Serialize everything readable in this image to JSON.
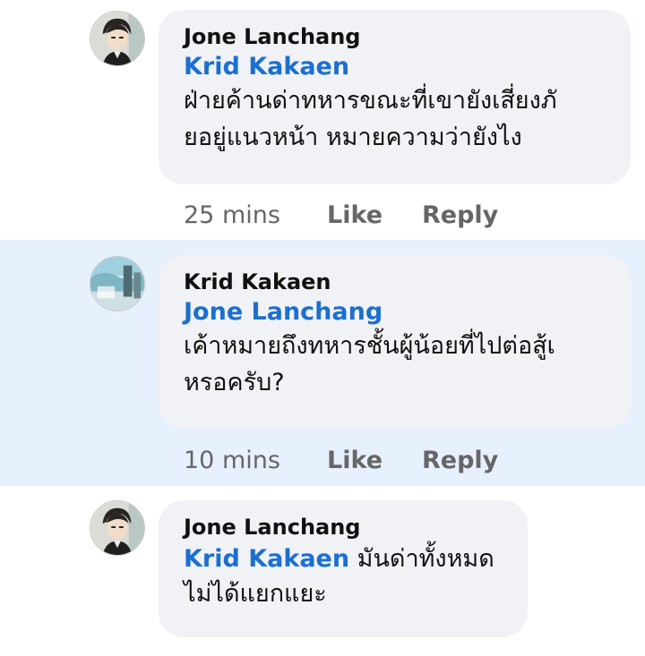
{
  "comments": [
    {
      "author": "Jone Lanchang",
      "mention": "Krid Kakaen",
      "lines": [
        "ฝ่ายค้านด่าทหารขณะที่เขายังเสี่ยงภั",
        "ยอยู่แนวหน้า หมายความว่ายังไง"
      ],
      "time": "25 mins",
      "like": "Like",
      "reply": "Reply",
      "avatar": "avatar-anime-dark-hair",
      "highlighted": false
    },
    {
      "author": "Krid Kakaen",
      "mention": "Jone Lanchang",
      "lines": [
        "เค้าหมายถึงทหารชั้นผู้น้อยที่ไปต่อสู้เ",
        "หรอครับ?"
      ],
      "time": "10 mins",
      "like": "Like",
      "reply": "Reply",
      "avatar": "avatar-landscape-teal",
      "highlighted": true
    },
    {
      "author": "Jone Lanchang",
      "mention": "Krid Kakaen",
      "inline_text": "มันด่าทั้งหมด",
      "lines": [
        "ไม่ได้แยกแยะ"
      ],
      "avatar": "avatar-anime-dark-hair",
      "highlighted": false
    }
  ],
  "colors": {
    "highlight_bg": "#e7f0fd",
    "bubble_bg": "#f0f2f5",
    "mention": "#1c6fd0"
  }
}
